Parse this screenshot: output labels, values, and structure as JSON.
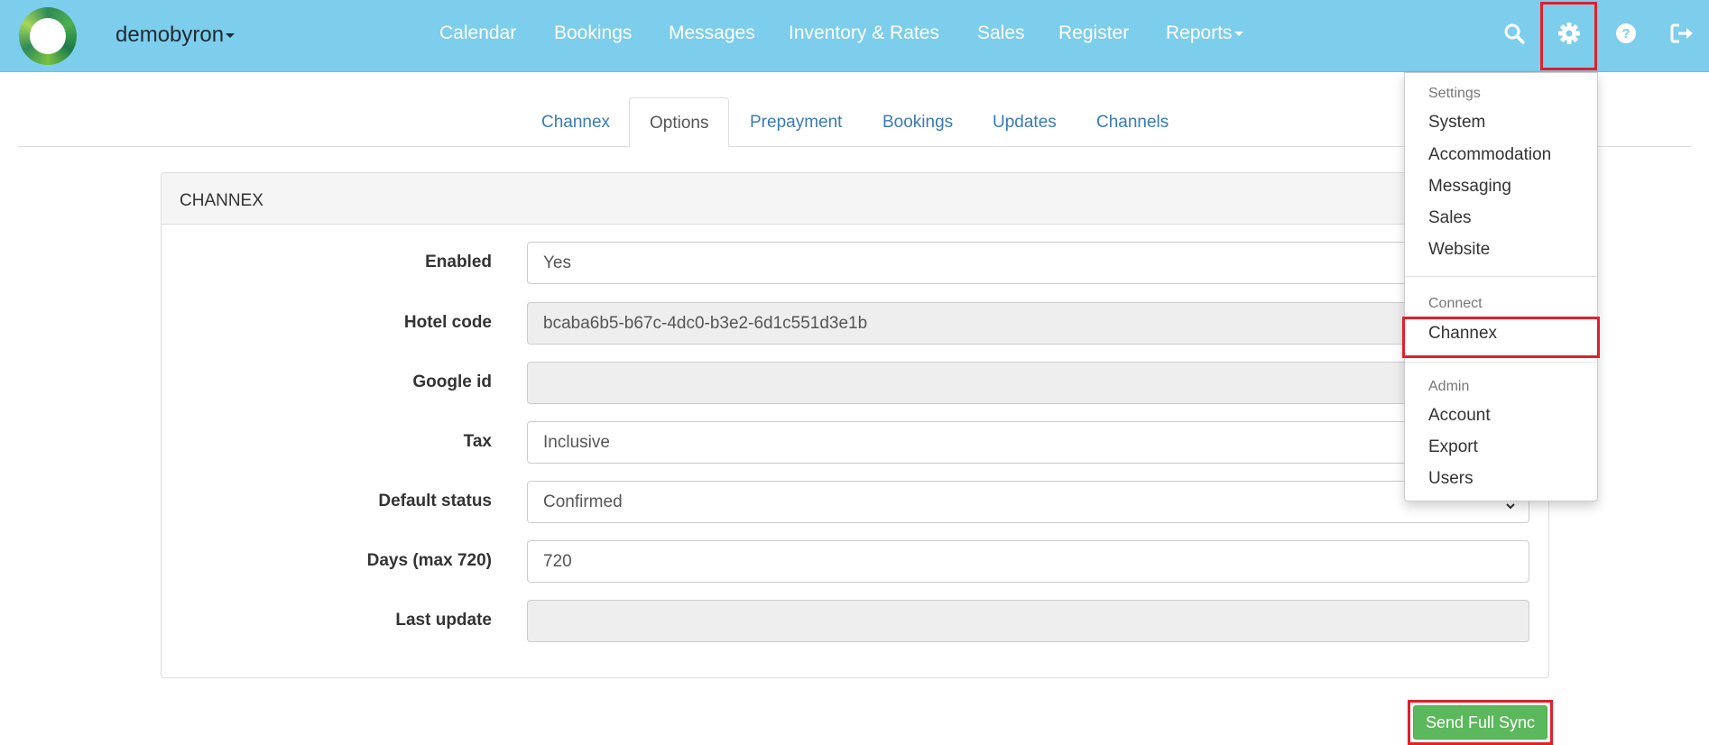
{
  "navbar": {
    "brand": "demobyron",
    "links": [
      "Calendar",
      "Bookings",
      "Messages",
      "Inventory & Rates",
      "Sales",
      "Register",
      "Reports"
    ],
    "icons": [
      "search-icon",
      "gear-icon",
      "help-icon",
      "logout-icon"
    ]
  },
  "tabs": [
    "Channex",
    "Options",
    "Prepayment",
    "Bookings",
    "Updates",
    "Channels"
  ],
  "active_tab": "Options",
  "panel": {
    "heading": "CHANNEX",
    "fields": [
      {
        "label": "Enabled",
        "value": "Yes"
      },
      {
        "label": "Hotel code",
        "value": "bcaba6b5-b67c-4dc0-b3e2-6d1c551d3e1b"
      },
      {
        "label": "Google id",
        "value": ""
      },
      {
        "label": "Tax",
        "value": "Inclusive"
      },
      {
        "label": "Default status",
        "value": "Confirmed"
      },
      {
        "label": "Days (max 720)",
        "value": "720"
      },
      {
        "label": "Last update",
        "value": ""
      }
    ]
  },
  "dropdown": {
    "settings_header": "Settings",
    "settings_items": [
      "System",
      "Accommodation",
      "Messaging",
      "Sales",
      "Website"
    ],
    "connect_header": "Connect",
    "connect_items": [
      "Channex"
    ],
    "admin_header": "Admin",
    "admin_items": [
      "Account",
      "Export",
      "Users"
    ]
  },
  "actions": {
    "sync_label": "Send Full Sync"
  },
  "colors": {
    "navbar": "#7dcdec",
    "highlight": "#e21f2b",
    "primary_button": "#5cb85c",
    "link": "#3a7ab8"
  }
}
